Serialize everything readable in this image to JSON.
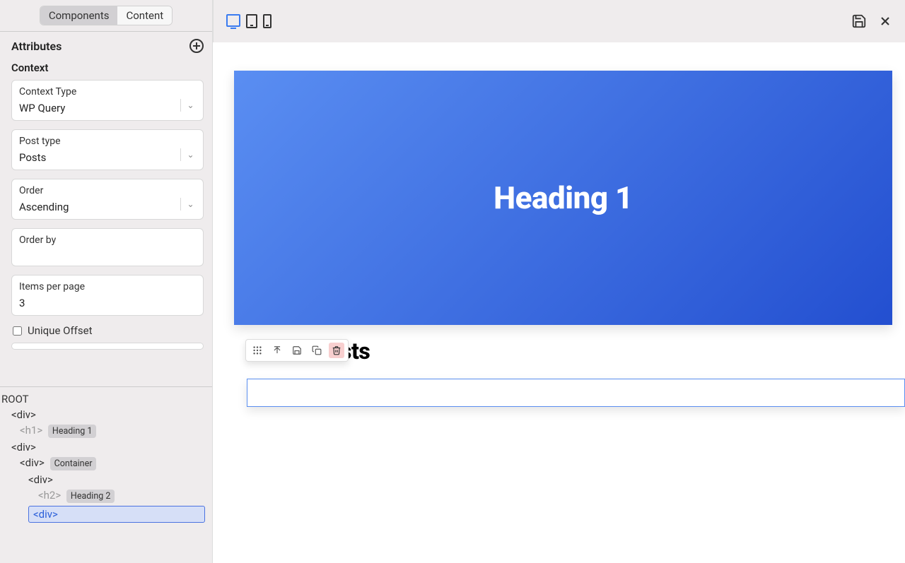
{
  "tabs": {
    "components": "Components",
    "content": "Content"
  },
  "attributes": {
    "title": "Attributes"
  },
  "context": {
    "title": "Context",
    "context_type": {
      "label": "Context Type",
      "value": "WP Query"
    },
    "post_type": {
      "label": "Post type",
      "value": "Posts"
    },
    "order": {
      "label": "Order",
      "value": "Ascending"
    },
    "order_by": {
      "label": "Order by",
      "value": ""
    },
    "items_per_page": {
      "label": "Items per page",
      "value": "3"
    },
    "unique_offset": {
      "label": "Unique Offset"
    }
  },
  "tree": {
    "root": "ROOT",
    "div1": "<div>",
    "h1": "<h1>",
    "h1_chip": "Heading 1",
    "div2": "<div>",
    "div_container": "<div>",
    "container_chip": "Container",
    "div3": "<div>",
    "h2": "<h2>",
    "h2_chip": "Heading 2",
    "div_selected": "<div>"
  },
  "canvas": {
    "hero_heading": "Heading 1",
    "latest_heading": "Latest Posts"
  }
}
